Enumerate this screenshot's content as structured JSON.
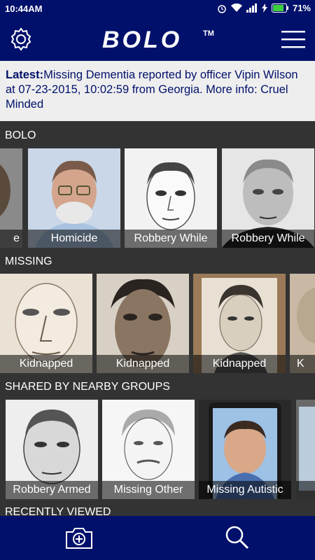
{
  "status": {
    "time": "10:44AM",
    "battery": "71%"
  },
  "app": {
    "title": "BOLO",
    "tm": "TM"
  },
  "latest": {
    "label": "Latest:",
    "message": "Missing Dementia reported by officer Vipin Wilson at 07-23-2015, 10:02:59 from Georgia. More info: Cruel Minded"
  },
  "sections": [
    {
      "title": "BOLO",
      "cards": [
        "e",
        "Homicide",
        "Robbery While",
        "Robbery While"
      ]
    },
    {
      "title": "MISSING",
      "cards": [
        "Kidnapped",
        "Kidnapped",
        "Kidnapped",
        "K"
      ]
    },
    {
      "title": "SHARED BY NEARBY GROUPS",
      "cards": [
        "Robbery Armed",
        "Missing Other",
        "Missing Autistic",
        ""
      ]
    },
    {
      "title": "RECENTLY VIEWED"
    }
  ],
  "icons": {
    "settings": "gear-icon",
    "menu": "hamburger-icon",
    "camera": "camera-add-icon",
    "search": "search-icon"
  }
}
